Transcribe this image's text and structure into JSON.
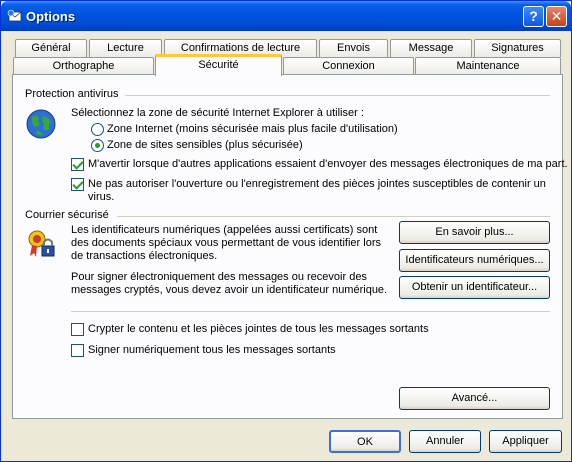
{
  "window": {
    "title": "Options",
    "help_label": "?",
    "close_label": "✕"
  },
  "tabs_row1": [
    "Général",
    "Lecture",
    "Confirmations de lecture",
    "Envois",
    "Message",
    "Signatures"
  ],
  "tabs_row2": [
    "Orthographe",
    "Sécurité",
    "Connexion",
    "Maintenance"
  ],
  "active_tab": "Sécurité",
  "antivirus": {
    "heading": "Protection antivirus",
    "zone_prompt": "Sélectionnez la zone de sécurité Internet Explorer à utiliser :",
    "zone_internet": "Zone Internet (moins sécurisée mais plus facile d'utilisation)",
    "zone_sensitive": "Zone de sites sensibles (plus sécurisée)",
    "warn_apps": "M'avertir lorsque d'autres applications essaient d'envoyer des messages électroniques de ma part.",
    "block_attachments": "Ne pas autoriser l'ouverture ou l'enregistrement des pièces jointes susceptibles de contenir un virus."
  },
  "secure_mail": {
    "heading": "Courrier sécurisé",
    "ids_text": "Les identificateurs numériques (appelées aussi certificats) sont des documents spéciaux vous permettant de vous identifier lors de transactions électroniques.",
    "sign_text": "Pour signer électroniquement des messages ou recevoir des messages cryptés, vous devez avoir un identificateur numérique.",
    "learn_more": "En savoir plus...",
    "digital_ids": "Identificateurs numériques...",
    "get_id": "Obtenir un identificateur...",
    "encrypt_all": "Crypter le contenu et les pièces jointes de tous les messages sortants",
    "sign_all": "Signer numériquement tous les messages sortants",
    "advanced": "Avancé..."
  },
  "footer": {
    "ok": "OK",
    "cancel": "Annuler",
    "apply": "Appliquer"
  }
}
